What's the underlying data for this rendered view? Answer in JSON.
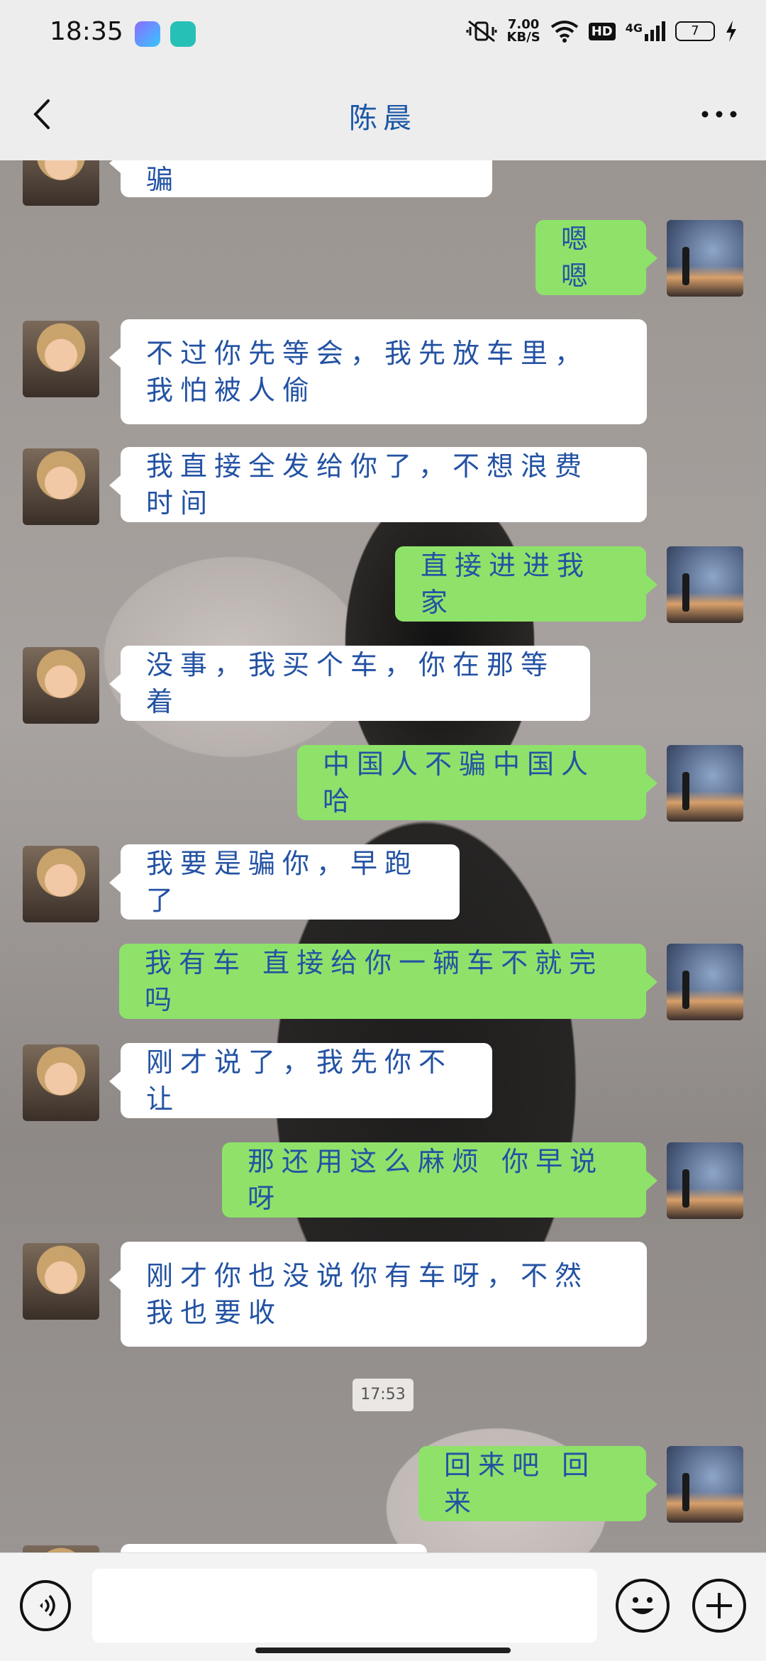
{
  "status_bar": {
    "time": "18:35",
    "net_speed_value": "7.00",
    "net_speed_unit": "KB/S",
    "hd_label": "HD",
    "signal_label": "4G",
    "battery_level": "7"
  },
  "header": {
    "title": "陈晨",
    "back_icon": "chevron-left-icon",
    "more_icon": "more-horizontal-icon"
  },
  "messages": [
    {
      "side": "left",
      "text": "大家都是中国人，不骗"
    },
    {
      "side": "right",
      "text": "嗯嗯"
    },
    {
      "side": "left",
      "text": "不过你先等会，我先放车里，我怕被人偷"
    },
    {
      "side": "left",
      "text": "我直接全发给你了，不想浪费时间"
    },
    {
      "side": "right",
      "text": "直接进进我家"
    },
    {
      "side": "left",
      "text": "没事，我买个车，你在那等着"
    },
    {
      "side": "right",
      "text": "中国人不骗中国人哈"
    },
    {
      "side": "left",
      "text": "我要是骗你，早跑了"
    },
    {
      "side": "right",
      "text": "我有车 直接给你一辆车不就完吗"
    },
    {
      "side": "left",
      "text": "刚才说了，我先你不让"
    },
    {
      "side": "right",
      "text": "那还用这么麻烦 你早说呀"
    },
    {
      "side": "left",
      "text": "刚才你也没说你有车呀，不然我也要收"
    },
    {
      "side": "right",
      "text": "回来吧 回来"
    }
  ],
  "timestamp": "17:53",
  "input_bar": {
    "voice_icon": "voice-icon",
    "text_value": "",
    "emoji_icon": "emoji-icon",
    "plus_icon": "plus-icon"
  }
}
